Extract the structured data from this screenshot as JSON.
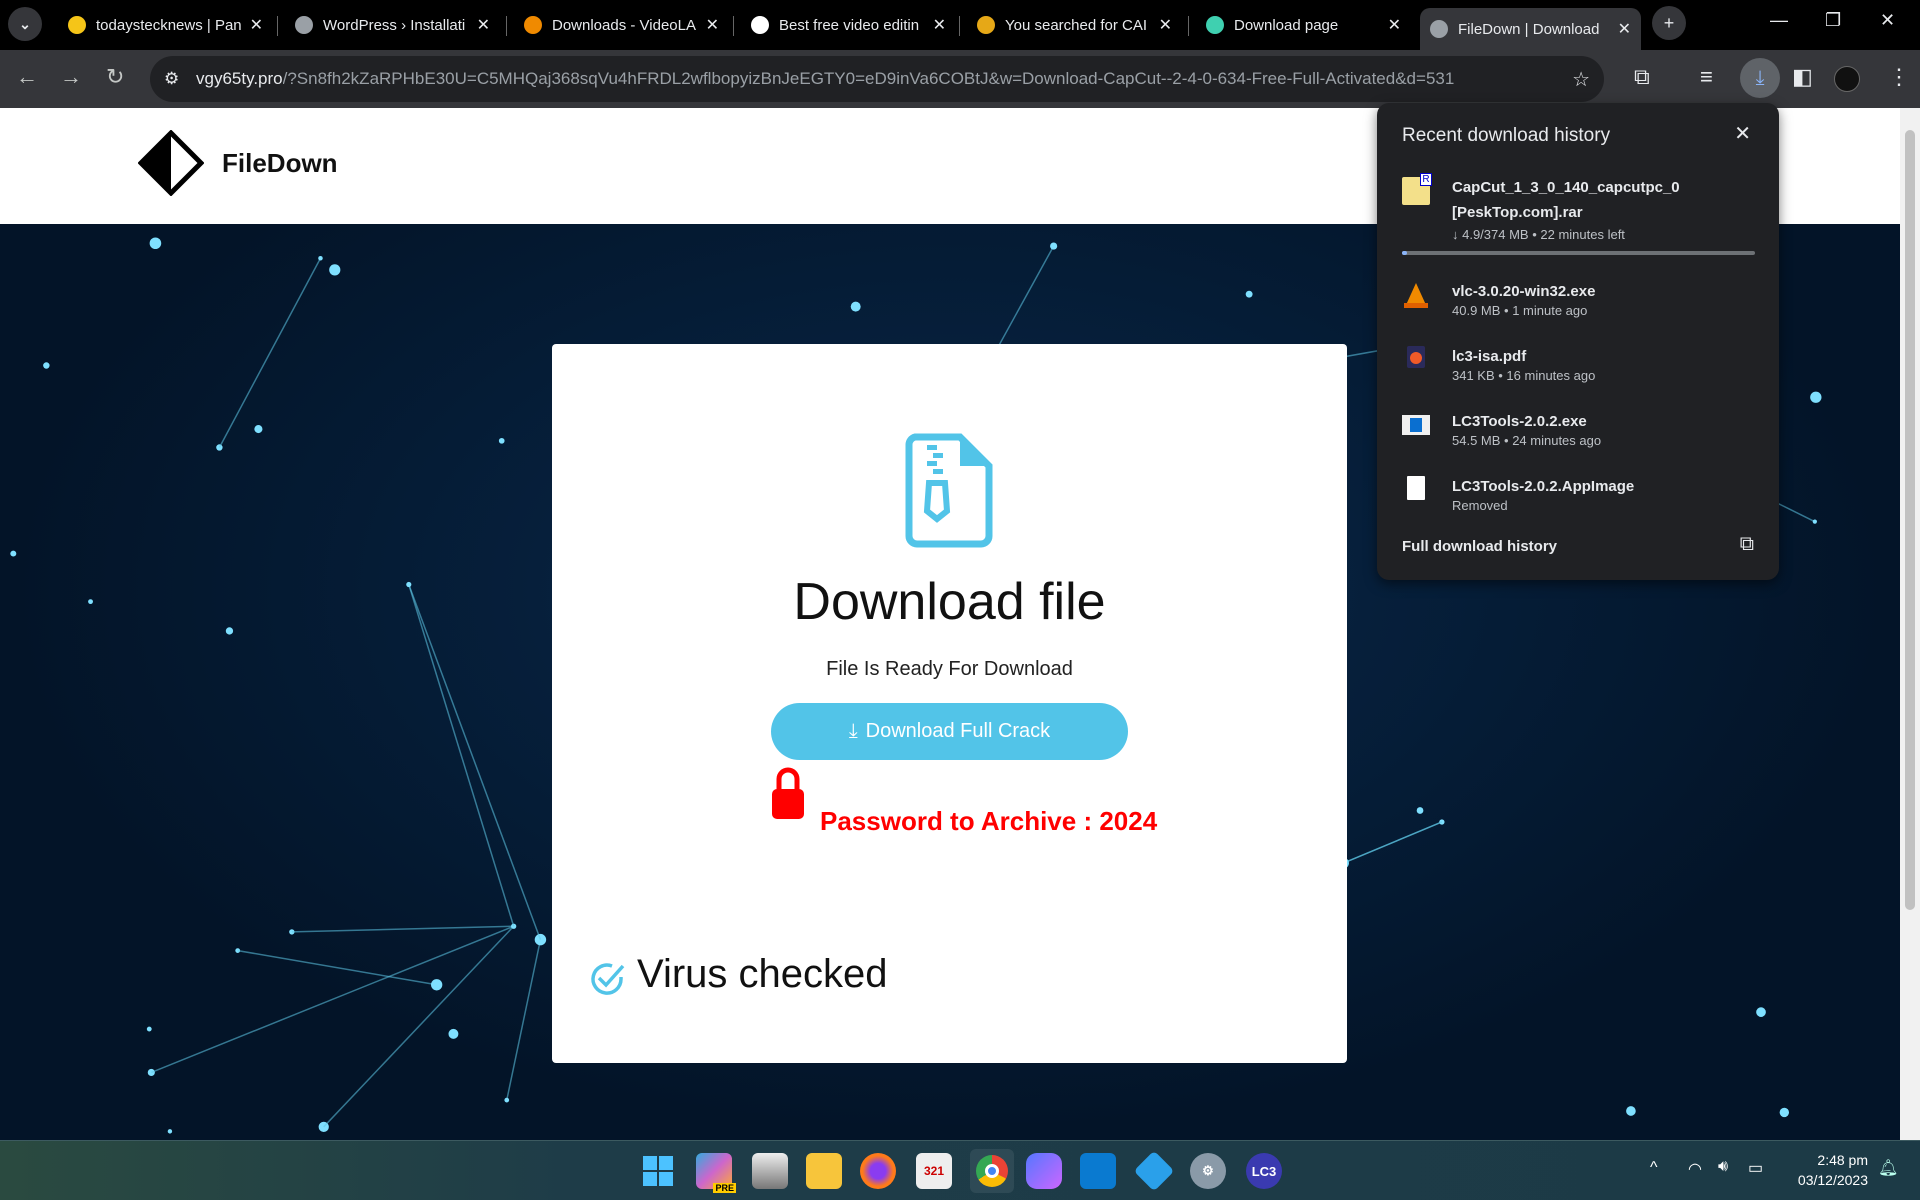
{
  "browser": {
    "tabs": [
      {
        "title": "todaystecknews | Pan",
        "icon": "bolt-icon",
        "color": "#f5c518"
      },
      {
        "title": "WordPress › Installati",
        "icon": "wordpress-icon",
        "color": "#9aa0a6"
      },
      {
        "title": "Downloads - VideoLA",
        "icon": "vlc-icon",
        "color": "#f08a00"
      },
      {
        "title": "Best free video editin",
        "icon": "capcut-icon",
        "color": "#ffffff"
      },
      {
        "title": "You searched for CAI",
        "icon": "g-icon",
        "color": "#e6a817"
      },
      {
        "title": "Download page",
        "icon": "download-page-icon",
        "color": "#3fd0b0"
      },
      {
        "title": "FileDown | Download",
        "icon": "globe-icon",
        "color": "#9aa0a6",
        "active": true
      }
    ],
    "url_host": "vgy65ty.pro",
    "url_rest": "/?Sn8fh2kZaRPHbE30U=C5MHQaj368sqVu4hFRDL2wflbopyizBnJeEGTY0=eD9inVa6COBtJ&w=Download-CapCut--2-4-0-634-Free-Full-Activated&d=531"
  },
  "site": {
    "brand": "FileDown"
  },
  "card": {
    "title": "Download file",
    "subtitle": "File Is Ready For Download",
    "button": "Download Full Crack",
    "password": "Password to Archive : 2024",
    "virus": "Virus checked",
    "accent": "#52c4e8"
  },
  "downloads": {
    "title": "Recent download history",
    "items": [
      {
        "name": "CapCut_1_3_0_140_capcutpc_0 [PeskTop.com].rar",
        "meta": "↓ 4.9/374 MB • 22 minutes left",
        "progress": 0.013
      },
      {
        "name": "vlc-3.0.20-win32.exe",
        "meta": "40.9 MB • 1 minute ago"
      },
      {
        "name": "lc3-isa.pdf",
        "meta": "341 KB • 16 minutes ago"
      },
      {
        "name": "LC3Tools-2.0.2.exe",
        "meta": "54.5 MB • 24 minutes ago"
      },
      {
        "name": "LC3Tools-2.0.2.AppImage",
        "meta": "Removed"
      }
    ],
    "full_history": "Full download history"
  },
  "taskbar": {
    "time": "2:48 pm",
    "date": "03/12/2023",
    "lc3": "LC3",
    "pre": "PRE"
  }
}
